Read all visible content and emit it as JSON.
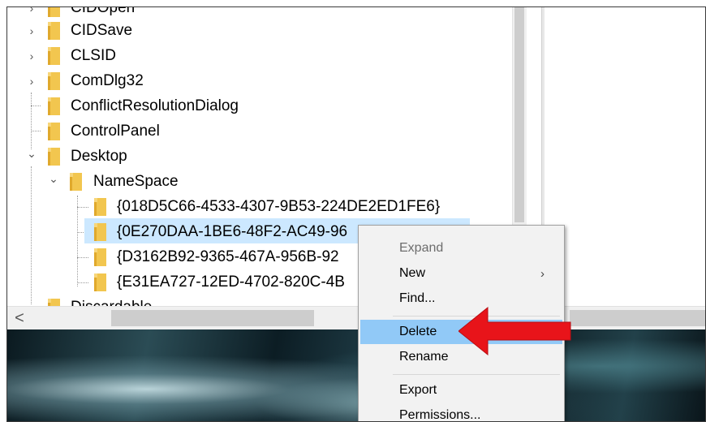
{
  "tree": {
    "items": [
      {
        "label": "CIDOpen",
        "expander": "right"
      },
      {
        "label": "CIDSave",
        "expander": "right"
      },
      {
        "label": "CLSID",
        "expander": "right"
      },
      {
        "label": "ComDlg32",
        "expander": "right"
      },
      {
        "label": "ConflictResolutionDialog",
        "expander": "none"
      },
      {
        "label": "ControlPanel",
        "expander": "none"
      },
      {
        "label": "Desktop",
        "expander": "down"
      },
      {
        "label": "NameSpace",
        "expander": "down"
      },
      {
        "label": "{018D5C66-4533-4307-9B53-224DE2ED1FE6}",
        "expander": "none"
      },
      {
        "label": "{0E270DAA-1BE6-48F2-AC49-96",
        "expander": "none",
        "selected": true
      },
      {
        "label": "{D3162B92-9365-467A-956B-92",
        "expander": "none"
      },
      {
        "label": "{E31EA727-12ED-4702-820C-4B",
        "expander": "none"
      },
      {
        "label": "Discardable",
        "expander": "right"
      }
    ]
  },
  "context_menu": {
    "items": [
      {
        "label": "Expand",
        "disabled": true
      },
      {
        "label": "New",
        "submenu": true,
        "arrow": "›"
      },
      {
        "label": "Find..."
      },
      {
        "label": "Delete",
        "highlighted": true
      },
      {
        "label": "Rename"
      },
      {
        "label": "Export"
      },
      {
        "label": "Permissions..."
      }
    ]
  },
  "scrollbar": {
    "left_arrow": "<"
  },
  "icons": {
    "chevron_right": "›",
    "chevron_down": "⌄",
    "folder": "folder-icon"
  },
  "colors": {
    "selection": "#cce8ff",
    "menu_highlight": "#91c9f7",
    "folder": "#f2c64f",
    "annotation_arrow": "#e8141a"
  }
}
